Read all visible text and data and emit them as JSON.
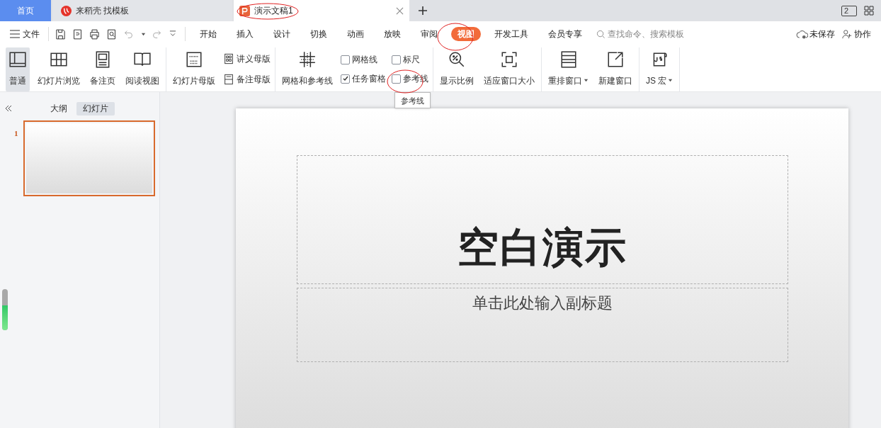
{
  "tabs": [
    {
      "label": "首页",
      "kind": "home",
      "selected": false
    },
    {
      "label": "来稻壳 找模板",
      "kind": "docer",
      "selected": false
    },
    {
      "label": "演示文稿1",
      "kind": "doc",
      "selected": true
    }
  ],
  "window_count": "2",
  "menu": {
    "file": "文件",
    "search": {
      "placeholder": "查找命令、搜索模板"
    },
    "save_status": "未保存",
    "collaborate": "协作"
  },
  "ribbon_tabs": [
    {
      "label": "开始",
      "selected": false
    },
    {
      "label": "插入",
      "selected": false
    },
    {
      "label": "设计",
      "selected": false
    },
    {
      "label": "切换",
      "selected": false
    },
    {
      "label": "动画",
      "selected": false
    },
    {
      "label": "放映",
      "selected": false
    },
    {
      "label": "审阅",
      "selected": false
    },
    {
      "label": "视图",
      "selected": true
    },
    {
      "label": "开发工具",
      "selected": false
    },
    {
      "label": "会员专享",
      "selected": false
    }
  ],
  "ribbon_groups": [
    {
      "items": [
        {
          "kind": "big",
          "label": "普通",
          "selected": true
        },
        {
          "kind": "big",
          "label": "幻灯片浏览",
          "selected": false
        },
        {
          "kind": "big",
          "label": "备注页",
          "selected": false
        },
        {
          "kind": "big",
          "label": "阅读视图",
          "selected": false
        }
      ]
    },
    {
      "items": [
        {
          "kind": "big",
          "label": "幻灯片母版",
          "selected": false
        },
        {
          "kind": "small",
          "label": "讲义母版"
        },
        {
          "kind": "small",
          "label": "备注母版"
        }
      ]
    },
    {
      "items": [
        {
          "kind": "big",
          "label": "网格和参考线",
          "selected": false
        },
        {
          "kind": "check",
          "label": "网格线",
          "checked": false
        },
        {
          "kind": "check",
          "label": "任务窗格",
          "checked": true
        },
        {
          "kind": "check",
          "label": "标尺",
          "checked": false
        },
        {
          "kind": "check",
          "label": "参考线",
          "checked": false
        }
      ]
    },
    {
      "items": [
        {
          "kind": "big",
          "label": "显示比例",
          "selected": false
        },
        {
          "kind": "big",
          "label": "适应窗口大小",
          "selected": false
        }
      ]
    },
    {
      "items": [
        {
          "kind": "big",
          "label": "重排窗口",
          "selected": false,
          "dropdown": true
        },
        {
          "kind": "big",
          "label": "新建窗口",
          "selected": false
        }
      ]
    },
    {
      "items": [
        {
          "kind": "big",
          "label": "JS 宏",
          "selected": false,
          "dropdown": true
        }
      ]
    }
  ],
  "tooltip": "参考线",
  "side_panel": {
    "tabs": [
      {
        "label": "大纲",
        "selected": false
      },
      {
        "label": "幻灯片",
        "selected": true
      }
    ],
    "slides": [
      {
        "number": "1",
        "selected": true
      }
    ]
  },
  "meter": {
    "level": 0.6
  },
  "slide": {
    "title": "空白演示",
    "subtitle": "单击此处输入副标题"
  }
}
